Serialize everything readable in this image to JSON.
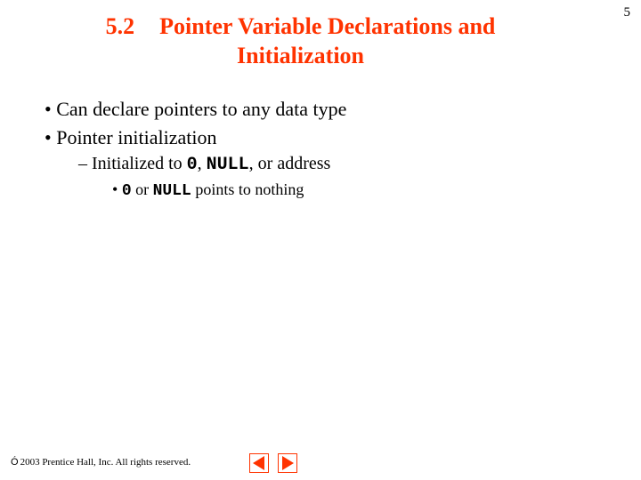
{
  "page_number": "5",
  "heading": {
    "section_number": "5.2",
    "title": "Pointer Variable Declarations and Initialization"
  },
  "bullets": {
    "b1": "Can declare pointers to any data type",
    "b2": "Pointer initialization",
    "b2_1_pre": "Initialized to ",
    "b2_1_code1": "0",
    "b2_1_mid1": ", ",
    "b2_1_code2": "NULL",
    "b2_1_post": ", or address",
    "b2_1_1_code1": "0",
    "b2_1_1_mid": " or ",
    "b2_1_1_code2": "NULL",
    "b2_1_1_post": " points to nothing"
  },
  "footer": {
    "symbol": "Ó",
    "text": " 2003 Prentice Hall, Inc.  All rights reserved."
  }
}
